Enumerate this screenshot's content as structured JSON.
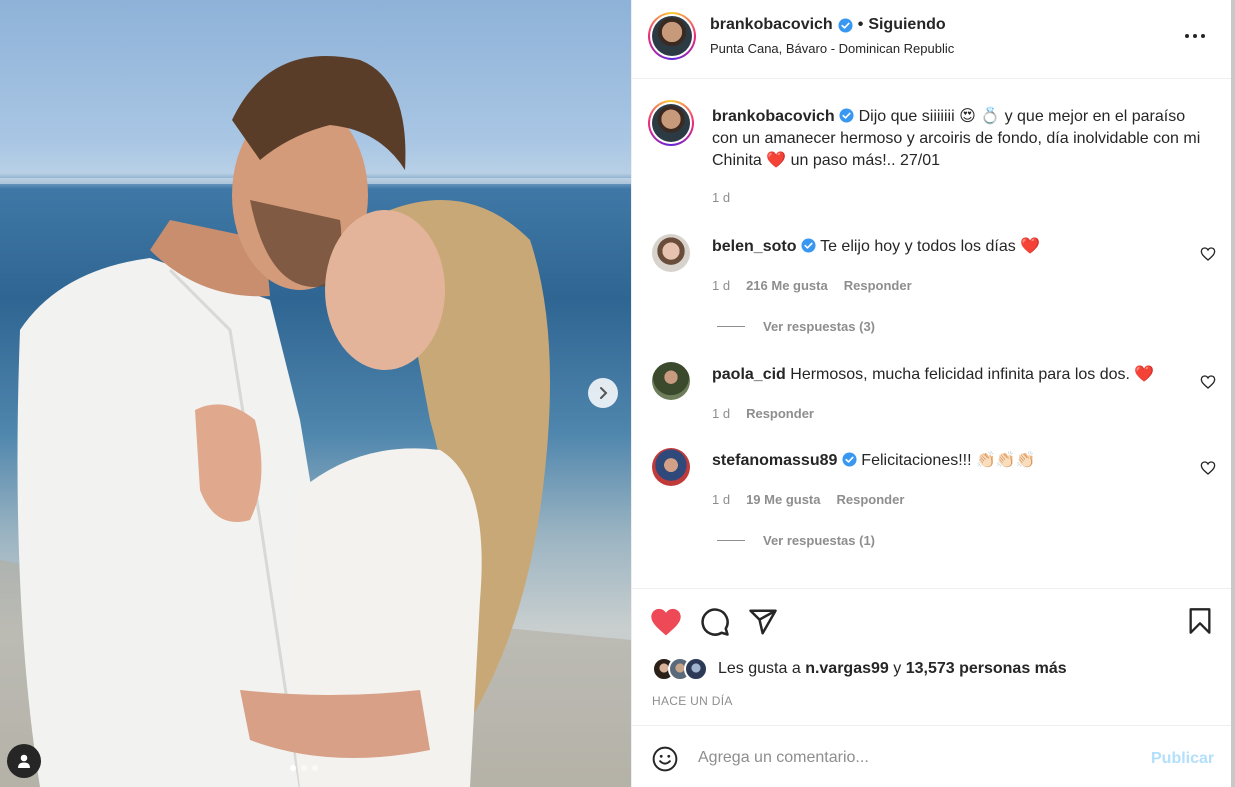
{
  "post": {
    "author": "brankobacovich",
    "follow_status": "Siguiendo",
    "bullet": "•",
    "location": "Punta Cana, Bávaro - Dominican Republic",
    "caption": "Dijo que siiiiiii 😍 💍 y que mejor en el paraíso con un amanecer hermoso y arcoiris de fondo, día inolvidable con mi Chinita ❤️ un paso más!.. 27/01",
    "caption_age": "1 d"
  },
  "comments": [
    {
      "user": "belen_soto",
      "verified": true,
      "text": "Te elijo hoy y todos los días ❤️",
      "age": "1 d",
      "likes": "216 Me gusta",
      "reply": "Responder",
      "replies": "Ver respuestas (3)"
    },
    {
      "user": "paola_cid",
      "verified": false,
      "text": "Hermosos, mucha felicidad infinita para los dos. ❤️",
      "age": "1 d",
      "likes": "",
      "reply": "Responder",
      "replies": ""
    },
    {
      "user": "stefanomassu89",
      "verified": true,
      "text": "Felicitaciones!!! 👏🏻👏🏻👏🏻",
      "age": "1 d",
      "likes": "19 Me gusta",
      "reply": "Responder",
      "replies": "Ver respuestas (1)"
    }
  ],
  "likes_bar": {
    "prefix": "Les gusta a",
    "first_user": "n.vargas99",
    "connector": "y",
    "others": "13,573 personas más"
  },
  "timestamp": "HACE UN DÍA",
  "composer": {
    "placeholder": "Agrega un comentario...",
    "publish_label": "Publicar"
  },
  "carousel": {
    "slides": 3,
    "active": 1
  },
  "colors": {
    "like_red": "#ed4956",
    "verified_blue": "#3897f0",
    "publish_disabled": "#b2dffc",
    "secondary_text": "#8e8e8e"
  },
  "icons": [
    "heart-filled-icon",
    "comment-icon",
    "share-icon",
    "bookmark-icon",
    "more-icon",
    "emoji-icon",
    "chevron-right-icon",
    "user-tag-icon",
    "heart-outline-icon",
    "verified-badge-icon"
  ]
}
